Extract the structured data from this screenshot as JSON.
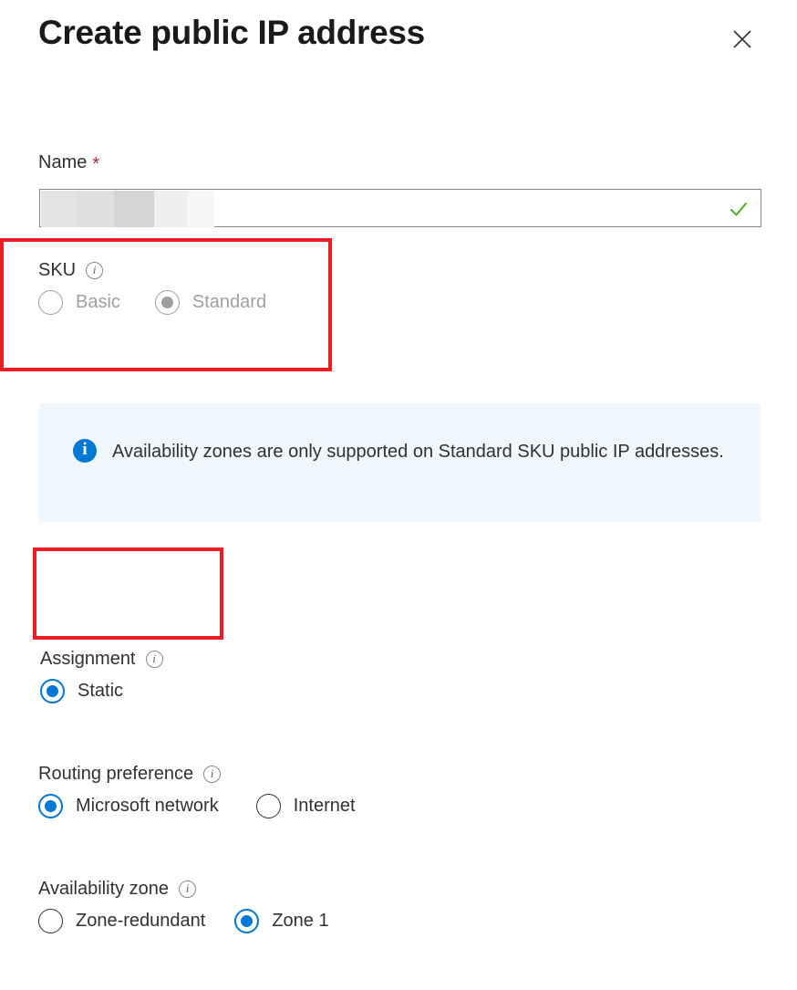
{
  "header": {
    "title": "Create public IP address",
    "close_label": "Close",
    "close_icon": "close-icon"
  },
  "form": {
    "name": {
      "label": "Name",
      "required_marker": "*",
      "value": "",
      "redacted": true,
      "validation_icon": "checkmark-icon",
      "validation_color": "#4caf27"
    },
    "sku": {
      "label": "SKU",
      "info_icon": "info-icon",
      "disabled": true,
      "selected": "Standard",
      "options": [
        {
          "label": "Basic",
          "checked": false
        },
        {
          "label": "Standard",
          "checked": true
        }
      ]
    },
    "info_banner": {
      "icon": "info-filled-icon",
      "icon_color": "#0078d4",
      "background": "#eff6fc",
      "text": "Availability zones are only supported on Standard SKU public IP addresses."
    },
    "assignment": {
      "label": "Assignment",
      "info_icon": "info-icon",
      "selected": "Static",
      "options": [
        {
          "label": "Static",
          "checked": true
        }
      ]
    },
    "routing_preference": {
      "label": "Routing preference",
      "info_icon": "info-icon",
      "selected": "Microsoft network",
      "options": [
        {
          "label": "Microsoft network",
          "checked": true
        },
        {
          "label": "Internet",
          "checked": false
        }
      ]
    },
    "availability_zone": {
      "label": "Availability zone",
      "info_icon": "info-icon",
      "selected": "Zone 1",
      "options": [
        {
          "label": "Zone-redundant",
          "checked": false
        },
        {
          "label": "Zone 1",
          "checked": true
        }
      ]
    }
  },
  "annotations": {
    "color": "#ee1c25",
    "boxes": [
      {
        "target": "sku-group"
      },
      {
        "target": "assignment-group"
      }
    ]
  }
}
